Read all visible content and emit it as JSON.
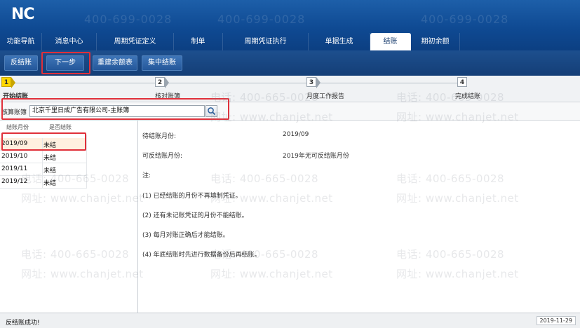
{
  "app": {
    "logo": "NC"
  },
  "watermark": {
    "phone": "电话: 400-665-0028",
    "site": "网址: www.chanjet.net",
    "header_phone": "400-699-0028"
  },
  "menu_tabs": [
    {
      "label": "功能导航"
    },
    {
      "label": "消息中心"
    },
    {
      "label": "周期凭证定义"
    },
    {
      "label": "制单"
    },
    {
      "label": "周期凭证执行"
    },
    {
      "label": "单据生成"
    },
    {
      "label": "结账",
      "active": true
    },
    {
      "label": "期初余额"
    }
  ],
  "toolbar": {
    "unclose_label": "反结账",
    "next_label": "下一步",
    "rebuild_label": "重建余额表",
    "collect_label": "集中结账"
  },
  "steps": [
    {
      "num": "1",
      "label": "开始结账",
      "active": true
    },
    {
      "num": "2",
      "label": "核对账簿"
    },
    {
      "num": "3",
      "label": "月度工作报告"
    },
    {
      "num": "4",
      "label": "完成结账"
    }
  ],
  "account": {
    "label": "核算账簿",
    "value": "北京千里日成广告有限公司-主账簿"
  },
  "period_table": {
    "headers": [
      "结账月份",
      "是否结账"
    ],
    "rows": [
      {
        "month": "2019/09",
        "status": "未结"
      },
      {
        "month": "2019/10",
        "status": "未结"
      },
      {
        "month": "2019/11",
        "status": "未结"
      },
      {
        "month": "2019/12",
        "status": "未结"
      }
    ]
  },
  "info": {
    "pending_label": "待结账月份:",
    "pending_value": "2019/09",
    "reversible_label": "可反结账月份:",
    "reversible_value": "2019年无可反结账月份",
    "note_label": "注:",
    "notes": [
      "(1) 已经结账的月份不再填制凭证。",
      "(2) 还有未记账凭证的月份不能结账。",
      "(3) 每月对账正确后才能结账。",
      "(4) 年底结账时先进行数据备份后再结账。"
    ]
  },
  "status": {
    "message": "反结账成功!",
    "date": "2019-11-29"
  },
  "colors": {
    "header": "#0f4a93",
    "highlight_box": "#e0303a",
    "step_active": "#ffd700"
  }
}
